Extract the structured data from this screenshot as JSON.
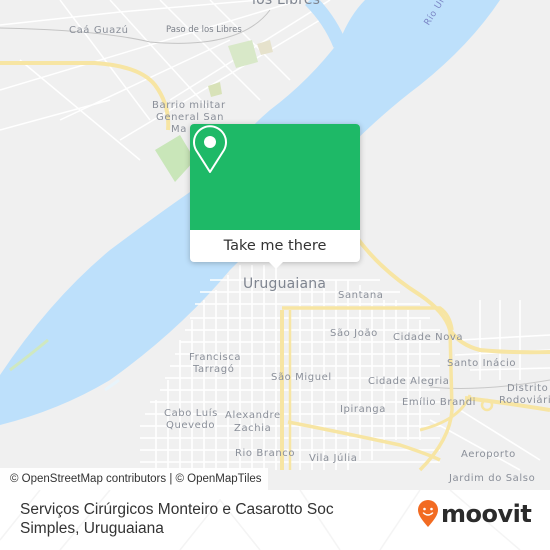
{
  "map": {
    "colors": {
      "land": "#f0f0f0",
      "water": "#bde0fb",
      "road_major": "#fbe9a8",
      "road_minor": "#ffffff",
      "park": "#cfe8c0",
      "label": "#8a8f99",
      "river_label": "#7b86c5"
    },
    "labels": {
      "los_libres_top": "los Libres",
      "caa_guazu": "Caá Guazú",
      "paso_de_los_libres": "Paso de los Libres",
      "barrio_militar": "Barrio militar General San Martín",
      "barrio_militar_l1": "Barrio militar",
      "barrio_militar_l2": "General San",
      "barrio_militar_l3": "Ma",
      "rio_uruguay": "Río Urug",
      "uruguaiana": "Uruguaiana",
      "santana": "Santana",
      "sao_joao": "São João",
      "cidade_nova": "Cidade Nova",
      "santo_inacio": "Santo Inácio",
      "distrito_l1": "Distrito",
      "distrito_l2": "Rodoviári",
      "francisca_l1": "Francisca",
      "francisca_l2": "Tarragó",
      "sao_miguel": "São Miguel",
      "cidade_alegria": "Cidade Alegria",
      "emilio_brandi": "Emílio Brandi",
      "ipiranga": "Ipiranga",
      "cabo_l1": "Cabo Luís",
      "cabo_l2": "Quevedo",
      "alexandre_l1": "Alexandre",
      "alexandre_l2": "Zachia",
      "rio_branco": "Rio Branco",
      "vila_julia": "Vila Júlia",
      "aeroporto": "Aeroporto",
      "jardim_do_salso": "Jardim do Salso"
    }
  },
  "popup": {
    "icon": "map-pin-icon",
    "button_label": "Take me there",
    "accent": "#1eb967"
  },
  "attribution": {
    "text": "© OpenStreetMap contributors | © OpenMapTiles"
  },
  "footer": {
    "title": "Serviços Cirúrgicos Monteiro e Casarotto Soc Simples, Uruguaiana",
    "logo_text": "moovit",
    "logo_icon": "moovit-pin-icon",
    "logo_color": "#f26b22"
  }
}
